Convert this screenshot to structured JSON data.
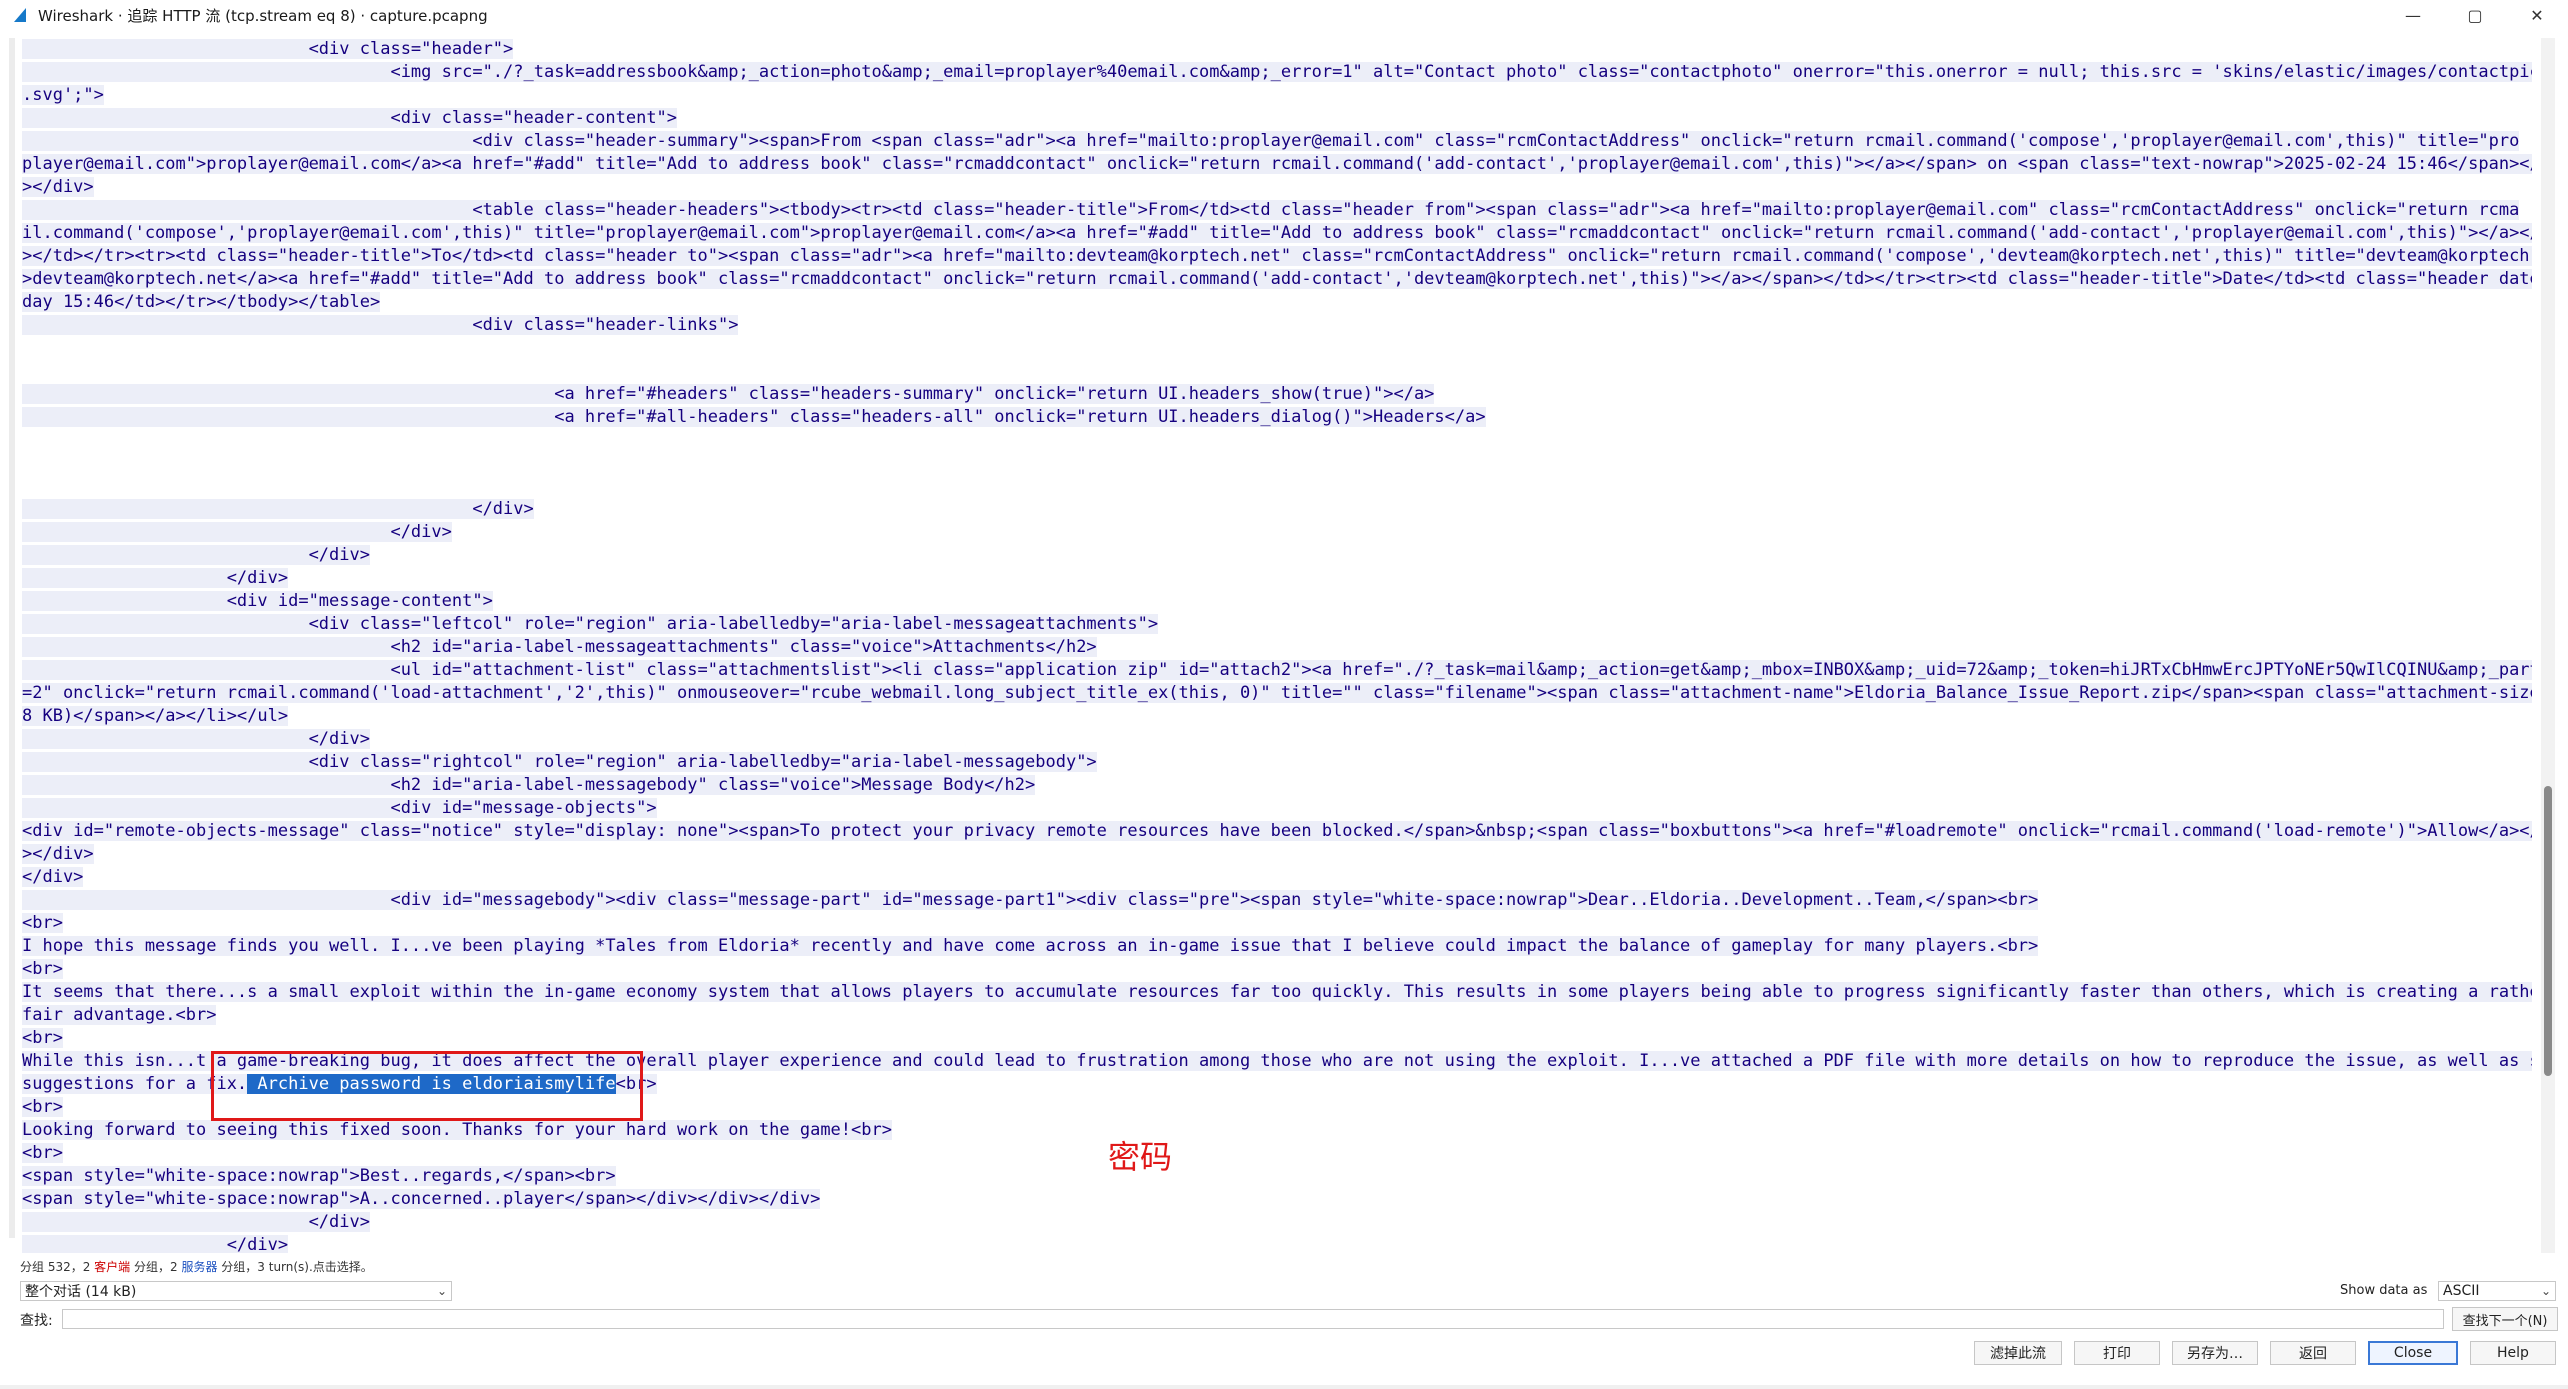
{
  "window": {
    "title": "Wireshark · 追踪 HTTP 流 (tcp.stream eq 8) · capture.pcapng",
    "controls": [
      "—",
      "▢",
      "✕"
    ]
  },
  "stream_lines": [
    "                            <div class=\"header\">",
    "                                    <img src=\"./?_task=addressbook&amp;_action=photo&amp;_email=proplayer%40email.com&amp;_error=1\" alt=\"Contact photo\" class=\"contactphoto\" onerror=\"this.onerror = null; this.src = 'skins/elastic/images/contactpic",
    ".svg';\">",
    "                                    <div class=\"header-content\">",
    "                                            <div class=\"header-summary\"><span>From <span class=\"adr\"><a href=\"mailto:proplayer@email.com\" class=\"rcmContactAddress\" onclick=\"return rcmail.command('compose','proplayer@email.com',this)\" title=\"pro",
    "player@email.com\">proplayer@email.com</a><a href=\"#add\" title=\"Add to address book\" class=\"rcmaddcontact\" onclick=\"return rcmail.command('add-contact','proplayer@email.com',this)\"></a></span> on <span class=\"text-nowrap\">2025-02-24 15:46</span></span",
    "></div>",
    "                                            <table class=\"header-headers\"><tbody><tr><td class=\"header-title\">From</td><td class=\"header from\"><span class=\"adr\"><a href=\"mailto:proplayer@email.com\" class=\"rcmContactAddress\" onclick=\"return rcma",
    "il.command('compose','proplayer@email.com',this)\" title=\"proplayer@email.com\">proplayer@email.com</a><a href=\"#add\" title=\"Add to address book\" class=\"rcmaddcontact\" onclick=\"return rcmail.command('add-contact','proplayer@email.com',this)\"></a></span",
    "></td></tr><tr><td class=\"header-title\">To</td><td class=\"header to\"><span class=\"adr\"><a href=\"mailto:devteam@korptech.net\" class=\"rcmContactAddress\" onclick=\"return rcmail.command('compose','devteam@korptech.net',this)\" title=\"devteam@korptech.net\"",
    ">devteam@korptech.net</a><a href=\"#add\" title=\"Add to address book\" class=\"rcmaddcontact\" onclick=\"return rcmail.command('add-contact','devteam@korptech.net',this)\"></a></span></td></tr><tr><td class=\"header-title\">Date</td><td class=\"header date\">To",
    "day 15:46</td></tr></tbody></table>",
    "                                            <div class=\"header-links\">",
    "",
    "",
    "                                                    <a href=\"#headers\" class=\"headers-summary\" onclick=\"return UI.headers_show(true)\"></a>",
    "                                                    <a href=\"#all-headers\" class=\"headers-all\" onclick=\"return UI.headers_dialog()\">Headers</a>",
    "",
    "",
    "",
    "                                            </div>",
    "                                    </div>",
    "                            </div>",
    "                    </div>",
    "                    <div id=\"message-content\">",
    "                            <div class=\"leftcol\" role=\"region\" aria-labelledby=\"aria-label-messageattachments\">",
    "                                    <h2 id=\"aria-label-messageattachments\" class=\"voice\">Attachments</h2>",
    "                                    <ul id=\"attachment-list\" class=\"attachmentslist\"><li class=\"application zip\" id=\"attach2\"><a href=\"./?_task=mail&amp;_action=get&amp;_mbox=INBOX&amp;_uid=72&amp;_token=hiJRTxCbHmwErcJPTYoNEr5QwIlCQINU&amp;_part",
    "=2\" onclick=\"return rcmail.command('load-attachment','2',this)\" onmouseover=\"rcube_webmail.long_subject_title_ex(this, 0)\" title=\"\" class=\"filename\"><span class=\"attachment-name\">Eldoria_Balance_Issue_Report.zip</span><span class=\"attachment-size\">(~",
    "8 KB)</span></a></li></ul>",
    "                            </div>",
    "                            <div class=\"rightcol\" role=\"region\" aria-labelledby=\"aria-label-messagebody\">",
    "                                    <h2 id=\"aria-label-messagebody\" class=\"voice\">Message Body</h2>",
    "                                    <div id=\"message-objects\">",
    "<div id=\"remote-objects-message\" class=\"notice\" style=\"display: none\"><span>To protect your privacy remote resources have been blocked.</span>&nbsp;<span class=\"boxbuttons\"><a href=\"#loadremote\" onclick=\"rcmail.command('load-remote')\">Allow</a></span",
    "></div>",
    "</div>",
    "                                    <div id=\"messagebody\"><div class=\"message-part\" id=\"message-part1\"><div class=\"pre\"><span style=\"white-space:nowrap\">Dear..Eldoria..Development..Team,</span><br>",
    "<br>",
    "I hope this message finds you well. I...ve been playing *Tales from Eldoria* recently and have come across an in-game issue that I believe could impact the balance of gameplay for many players.<br>",
    "<br>",
    "It seems that there...s a small exploit within the in-game economy system that allows players to accumulate resources far too quickly. This results in some players being able to progress significantly faster than others, which is creating a rather un",
    "fair advantage.<br>",
    "<br>",
    "While this isn...t a game-breaking bug, it does affect the overall player experience and could lead to frustration among those who are not using the exploit. I...ve attached a PDF file with more details on how to reproduce the issue, as well as some",
    "suggestions for a fix.",
    "<br>",
    "Looking forward to seeing this fixed soon. Thanks for your hard work on the game!<br>",
    "<br>",
    "<span style=\"white-space:nowrap\">Best..regards,</span><br>",
    "<span style=\"white-space:nowrap\">A..concerned..player</span></div></div></div>",
    "                            </div>",
    "                    </div>"
  ],
  "selection": {
    "text": " Archive password is eldoriaismylife",
    "after": "<br>"
  },
  "annotation": {
    "label": "密码",
    "color": "#e01818"
  },
  "status": {
    "prefix": "分组 532，2 ",
    "client": "客户端",
    "mid": " 分组，2 ",
    "server": "服务器",
    "suffix": " 分组，3 turn(s).点击选择。"
  },
  "conversation_select": {
    "value": "整个对话 (14 kB)"
  },
  "show_data": {
    "label": "Show data as",
    "value": "ASCII"
  },
  "find": {
    "label": "查找:",
    "value": "",
    "next_button": "查找下一个(N)"
  },
  "buttons": {
    "filter_out": "滤掉此流",
    "print": "打印",
    "save_as": "另存为…",
    "back": "返回",
    "close": "Close",
    "help": "Help"
  },
  "colors": {
    "client_text": "#15007f",
    "selection_bg": "#1e69c8",
    "highlight_box": "#e01818"
  }
}
